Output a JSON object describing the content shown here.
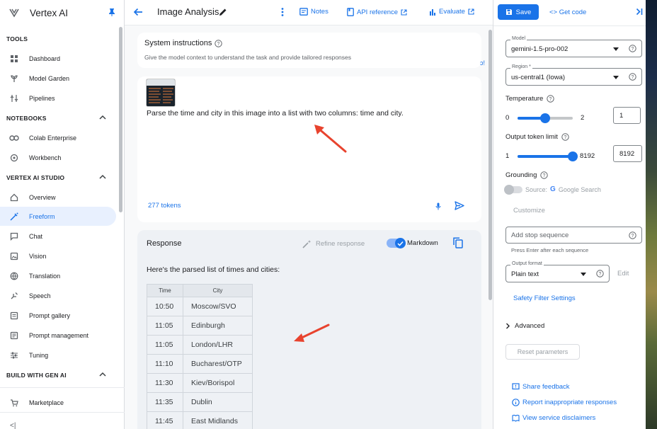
{
  "sidebar": {
    "app_title": "Vertex AI",
    "sections": {
      "tools": "TOOLS",
      "notebooks": "NOTEBOOKS",
      "studio": "VERTEX AI STUDIO",
      "build": "BUILD WITH GEN AI"
    },
    "items": [
      {
        "label": "Dashboard",
        "icon": "dashboard-icon"
      },
      {
        "label": "Model Garden",
        "icon": "model-garden-icon"
      },
      {
        "label": "Pipelines",
        "icon": "pipelines-icon"
      },
      {
        "label": "Colab Enterprise",
        "icon": "colab-icon"
      },
      {
        "label": "Workbench",
        "icon": "workbench-icon"
      },
      {
        "label": "Overview",
        "icon": "home-icon"
      },
      {
        "label": "Freeform",
        "icon": "freeform-icon",
        "active": true
      },
      {
        "label": "Chat",
        "icon": "chat-icon"
      },
      {
        "label": "Vision",
        "icon": "vision-icon"
      },
      {
        "label": "Translation",
        "icon": "translation-icon"
      },
      {
        "label": "Speech",
        "icon": "speech-icon"
      },
      {
        "label": "Prompt gallery",
        "icon": "prompt-gallery-icon"
      },
      {
        "label": "Prompt management",
        "icon": "prompt-management-icon"
      },
      {
        "label": "Tuning",
        "icon": "tuning-icon"
      },
      {
        "label": "Marketplace",
        "icon": "marketplace-icon"
      }
    ],
    "collapse_label": "<|"
  },
  "header": {
    "title": "Image Analysis",
    "links": {
      "notes": "Notes",
      "api_reference": "API reference",
      "evaluate": "Evaluate"
    }
  },
  "system_instructions": {
    "title": "System instructions",
    "subtitle": "Give the model context to understand the task and provide tailored responses",
    "overflow_glyph": "ɔ!"
  },
  "prompt": {
    "text": "Parse the time and city in this image into a list with two columns: time and city.",
    "tokens": "277 tokens"
  },
  "response": {
    "title": "Response",
    "refine_label": "Refine response",
    "markdown_label": "Markdown",
    "markdown_enabled": true,
    "intro": "Here's the parsed list of times and cities:",
    "table": {
      "headers": [
        "Time",
        "City"
      ],
      "rows": [
        [
          "10:50",
          "Moscow/SVO"
        ],
        [
          "11:05",
          "Edinburgh"
        ],
        [
          "11:05",
          "London/LHR"
        ],
        [
          "11:10",
          "Bucharest/OTP"
        ],
        [
          "11:30",
          "Kiev/Borispol"
        ],
        [
          "11:35",
          "Dublin"
        ],
        [
          "11:45",
          "East Midlands"
        ]
      ]
    }
  },
  "settings": {
    "save_label": "Save",
    "get_code_label": "Get code",
    "model": {
      "label": "Model",
      "value": "gemini-1.5-pro-002"
    },
    "region": {
      "label": "Region *",
      "value": "us-central1 (Iowa)"
    },
    "temperature": {
      "label": "Temperature",
      "min": "0",
      "max": "2",
      "value": "1",
      "fraction": 0.5
    },
    "output_token_limit": {
      "label": "Output token limit",
      "min": "1",
      "max": "8192",
      "value": "8192",
      "fraction": 1.0
    },
    "grounding": {
      "label": "Grounding",
      "source_label": "Source:",
      "source_value": "Google Search",
      "customize_label": "Customize",
      "enabled": false
    },
    "stop_sequence": {
      "placeholder": "Add stop sequence",
      "helper": "Press Enter after each sequence"
    },
    "output_format": {
      "label": "Output format",
      "value": "Plain text",
      "edit_label": "Edit"
    },
    "safety_label": "Safety Filter Settings",
    "advanced_label": "Advanced",
    "reset_label": "Reset parameters",
    "footer_links": {
      "feedback": "Share feedback",
      "report": "Report inappropriate responses",
      "disclaimers": "View service disclaimers"
    }
  },
  "colors": {
    "accent": "#1a73e8",
    "annotation_arrow": "#e8432e",
    "active_nav_bg": "#e8f0fe"
  }
}
